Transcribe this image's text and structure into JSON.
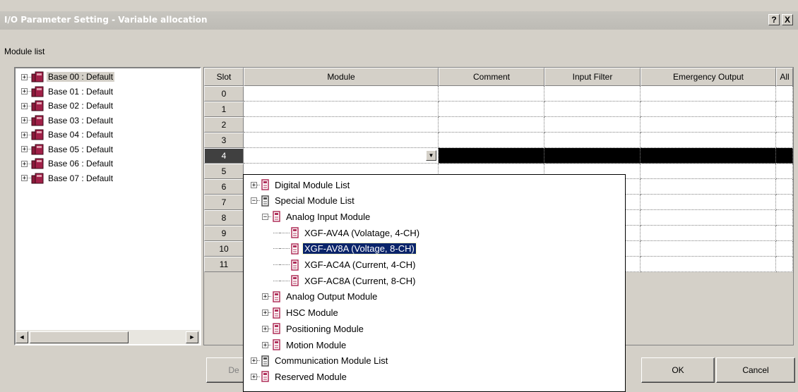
{
  "window": {
    "title": "I/O Parameter Setting - Variable allocation",
    "help_label": "?",
    "close_label": "X"
  },
  "module_list_label": "Module list",
  "bases": [
    {
      "label": "Base 00 : Default",
      "expander": "+"
    },
    {
      "label": "Base 01 : Default",
      "expander": "+"
    },
    {
      "label": "Base 02 : Default",
      "expander": "+"
    },
    {
      "label": "Base 03 : Default",
      "expander": "+"
    },
    {
      "label": "Base 04 : Default",
      "expander": "+"
    },
    {
      "label": "Base 05 : Default",
      "expander": "+"
    },
    {
      "label": "Base 06 : Default",
      "expander": "+"
    },
    {
      "label": "Base 07 : Default",
      "expander": "+"
    }
  ],
  "scroll": {
    "left_arrow": "◄",
    "right_arrow": "►"
  },
  "grid": {
    "columns": [
      "Slot",
      "Module",
      "Comment",
      "Input Filter",
      "Emergency Output",
      "All"
    ],
    "slots": [
      "0",
      "1",
      "2",
      "3",
      "4",
      "5",
      "6",
      "7",
      "8",
      "9",
      "10",
      "11"
    ],
    "selected_slot": "4",
    "dropdown_arrow": "▼"
  },
  "popup": {
    "items": [
      {
        "label": "Digital Module List",
        "expander": "+"
      },
      {
        "label": "Special Module List",
        "expander": "−"
      },
      {
        "label": "Analog Input Module",
        "expander": "−"
      },
      {
        "label": "XGF-AV4A (Volatage, 4-CH)"
      },
      {
        "label": "XGF-AV8A (Voltage, 8-CH)"
      },
      {
        "label": "XGF-AC4A (Current, 4-CH)"
      },
      {
        "label": "XGF-AC8A (Current, 8-CH)"
      },
      {
        "label": "Analog Output Module",
        "expander": "+"
      },
      {
        "label": "HSC Module",
        "expander": "+"
      },
      {
        "label": "Positioning Module",
        "expander": "+"
      },
      {
        "label": "Motion Module",
        "expander": "+"
      },
      {
        "label": "Communication Module List",
        "expander": "+"
      },
      {
        "label": "Reserved Module",
        "expander": "+"
      }
    ],
    "selected_item": "XGF-AV8A (Voltage, 8-CH)"
  },
  "buttons": {
    "partial_label": "De",
    "ok_label": "OK",
    "cancel_label": "Cancel"
  },
  "colors": {
    "selection": "#0a246a",
    "dialog_bg": "#d4d0c8",
    "module_icon": "#8b1a3a"
  }
}
